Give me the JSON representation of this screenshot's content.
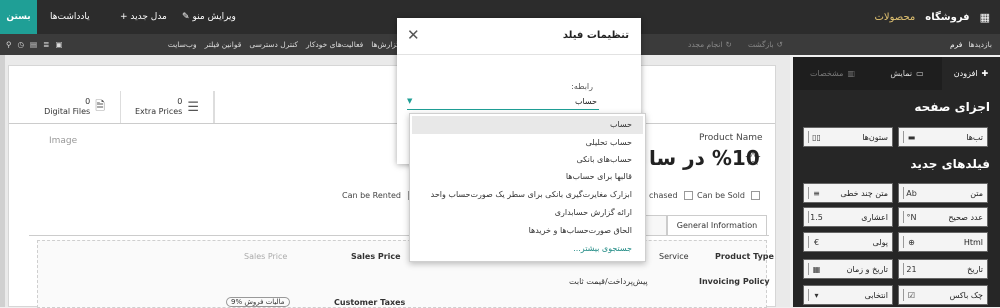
{
  "topbar": {
    "close_label": "بستن",
    "notes_label": "یادداشت‌ها",
    "new_model_label": "+ مدل جدید",
    "edit_menu_label": "ویرایش منو",
    "app_name": "فروشگاه",
    "menu_products": "محصولات"
  },
  "subbar": {
    "menu_items": [
      "گزارش‌ها",
      "فعالیت‌های خودکار",
      "کنترل دسترسی",
      "قوانین فیلتر",
      "وب‌سایت"
    ],
    "undo_label": "بازگشت",
    "redo_label": "انجام مجدد",
    "views_label": "بازدیدها",
    "form_label": "فرم"
  },
  "panel": {
    "tabs": {
      "add": "افزودن",
      "view": "نمایش",
      "properties": "مشخصات"
    },
    "page_parts_title": "اجزای صفحه",
    "page_parts": [
      {
        "label": "تب‌ها",
        "icon": "tabs-icon"
      },
      {
        "label": "ستون‌ها",
        "icon": "columns-icon"
      }
    ],
    "new_fields_title": "فیلدهای جدید",
    "fields": [
      {
        "label": "متن",
        "glyph": "Ab",
        "icon": "text-icon"
      },
      {
        "label": "متن چند خطی",
        "glyph": "≡",
        "icon": "multiline-text-icon"
      },
      {
        "label": "عدد صحیح",
        "glyph": "N°",
        "icon": "integer-icon"
      },
      {
        "label": "اعشاری",
        "glyph": "1.5",
        "icon": "decimal-icon"
      },
      {
        "label": "Html",
        "glyph": "⊕",
        "icon": "html-icon"
      },
      {
        "label": "پولی",
        "glyph": "€",
        "icon": "monetary-icon"
      },
      {
        "label": "تاریخ",
        "glyph": "21",
        "icon": "date-icon"
      },
      {
        "label": "تاریخ و زمان",
        "glyph": "▦",
        "icon": "datetime-icon"
      },
      {
        "label": "چک باکس",
        "glyph": "☑",
        "icon": "checkbox-icon"
      },
      {
        "label": "انتخابی",
        "glyph": "▾",
        "icon": "selection-icon"
      }
    ]
  },
  "form": {
    "smart_buttons": [
      {
        "count": "0",
        "label": "Extra Prices"
      },
      {
        "count": "0",
        "label": "Digital Files"
      }
    ],
    "image_label": "Image",
    "product_name_label": "Product Name",
    "product_title": "%10 در سا",
    "can_be_sold": "Can be Sold",
    "can_be_purchased": "chased",
    "can_be_rented": "Can be Rented",
    "tab_general": "General Information",
    "product_type_label": "Product Type",
    "product_type_value": "Service",
    "invoicing_policy_label": "Invoicing Policy",
    "invoicing_policy_value": "پیش‌پرداخت/قیمت ثابت",
    "sales_price_label": "Sales Price",
    "sales_price_placeholder": "Sales Price",
    "customer_taxes_label": "Customer Taxes",
    "tax_tag": "مالیات فروش %9"
  },
  "modal": {
    "title": "تنظیمات فیلد",
    "relation_label": "رابطه:",
    "relation_value": "حساب",
    "options": [
      "حساب",
      "حساب تحلیلی",
      "حساب‌های بانکی",
      "قالبها برای حساب‌ها",
      "ابزارک مغایرت‌گیری بانکی برای سطر یک صورت‌حساب واحد",
      "ارائه گزارش حسابداری",
      "الحاق صورت‌حساب‌ها و خریدها",
      "جستجوی بیشتر..."
    ]
  },
  "colors": {
    "accent": "#1f9f96",
    "topbar": "#2c2c2c",
    "panel": "#262626"
  }
}
